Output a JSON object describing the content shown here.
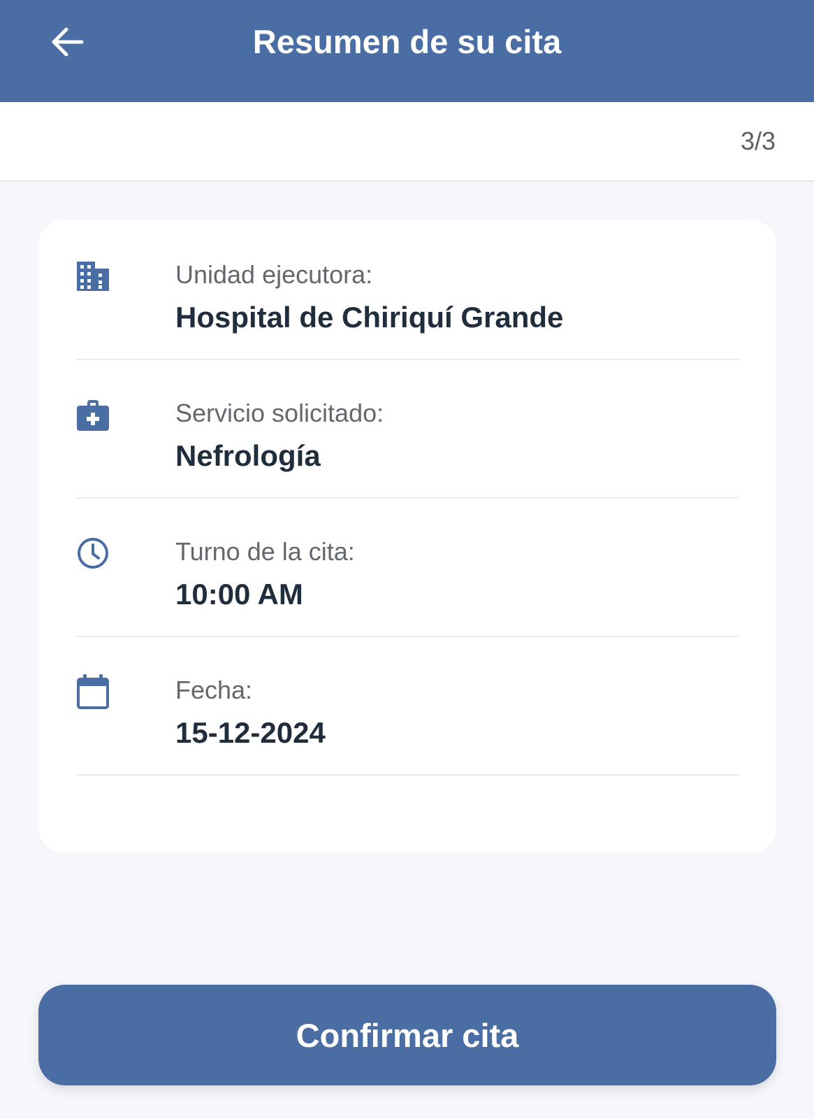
{
  "colors": {
    "primary": "#4a6da4",
    "header_text": "#ffffff",
    "background": "#f5f7fa",
    "card": "#ffffff",
    "label_text": "#63676e",
    "value_text": "#1f2d3d"
  },
  "header": {
    "back_icon": "arrow-left-icon",
    "title": "Resumen de su cita"
  },
  "steps": {
    "indicator": "3/3"
  },
  "summary": {
    "items": [
      {
        "icon": "building-icon",
        "label": "Unidad ejecutora:",
        "value": "Hospital de Chiriquí Grande"
      },
      {
        "icon": "medical-bag-icon",
        "label": "Servicio solicitado:",
        "value": "Nefrología"
      },
      {
        "icon": "clock-icon",
        "label": "Turno de la cita:",
        "value": "10:00 AM"
      },
      {
        "icon": "calendar-icon",
        "label": "Fecha:",
        "value": "15-12-2024"
      }
    ]
  },
  "actions": {
    "confirm_label": "Confirmar cita"
  }
}
